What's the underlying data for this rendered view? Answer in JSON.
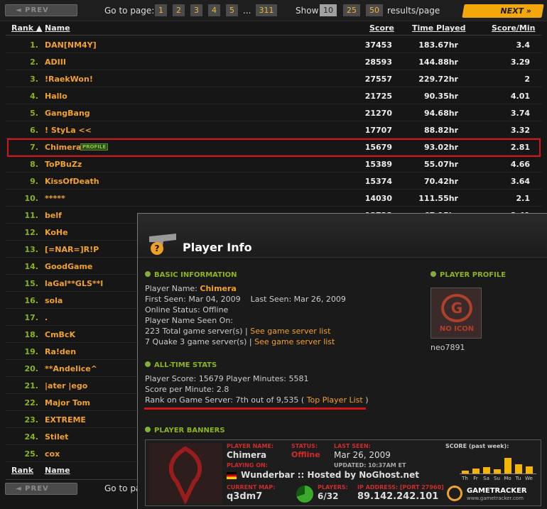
{
  "pager": {
    "prev": "◄ PREV",
    "next": "NEXT »",
    "goto_label": "Go to page:",
    "pages": [
      "1",
      "2",
      "3",
      "4",
      "5",
      "...",
      "311"
    ],
    "show_label": "Show",
    "show_options": [
      "10",
      "25",
      "50"
    ],
    "results_label": "results/page"
  },
  "table": {
    "headers": {
      "rank": "Rank ▲",
      "name": "Name",
      "score": "Score",
      "time": "Time Played",
      "spm": "Score/Min"
    },
    "rows": [
      {
        "rank": "1.",
        "name": "DAN[NM4Y]",
        "score": "37453",
        "time": "183.67hr",
        "spm": "3.4"
      },
      {
        "rank": "2.",
        "name": "ADIII",
        "score": "28593",
        "time": "144.88hr",
        "spm": "3.29"
      },
      {
        "rank": "3.",
        "name": "!RaekWon!",
        "score": "27557",
        "time": "229.72hr",
        "spm": "2"
      },
      {
        "rank": "4.",
        "name": "Hallo",
        "score": "21725",
        "time": "90.35hr",
        "spm": "4.01"
      },
      {
        "rank": "5.",
        "name": "GangBang",
        "score": "21270",
        "time": "94.68hr",
        "spm": "3.74"
      },
      {
        "rank": "6.",
        "name": "! StyLa <<",
        "score": "17707",
        "time": "88.82hr",
        "spm": "3.32"
      },
      {
        "rank": "7.",
        "name": "Chimera",
        "badge": "PROFILE",
        "score": "15679",
        "time": "93.02hr",
        "spm": "2.81"
      },
      {
        "rank": "8.",
        "name": "ToPBuZz",
        "score": "15389",
        "time": "55.07hr",
        "spm": "4.66"
      },
      {
        "rank": "9.",
        "name": "KissOfDeath",
        "score": "15374",
        "time": "70.42hr",
        "spm": "3.64"
      },
      {
        "rank": "10.",
        "name": "*****",
        "score": "14030",
        "time": "111.55hr",
        "spm": "2.1"
      },
      {
        "rank": "11.",
        "name": "belf",
        "score": "13723",
        "time": "67.15hr",
        "spm": "3.41"
      },
      {
        "rank": "12.",
        "name": "KoHe"
      },
      {
        "rank": "13.",
        "name": "[=NAR=]R!P"
      },
      {
        "rank": "14.",
        "name": "GoodGame"
      },
      {
        "rank": "15.",
        "name": "laGal**GLS**l"
      },
      {
        "rank": "16.",
        "name": "sola"
      },
      {
        "rank": "17.",
        "name": "."
      },
      {
        "rank": "18.",
        "name": "CmBcK"
      },
      {
        "rank": "19.",
        "name": "Ra!den"
      },
      {
        "rank": "20.",
        "name": "**Andelice^"
      },
      {
        "rank": "21.",
        "name": "|ater |ego"
      },
      {
        "rank": "22.",
        "name": "Major Tom"
      },
      {
        "rank": "23.",
        "name": "EXTREME"
      },
      {
        "rank": "24.",
        "name": "Stilet"
      },
      {
        "rank": "25.",
        "name": "cox"
      }
    ],
    "footer_rank": "Rank",
    "footer_name": "Name",
    "footer_goto": "Go to pa"
  },
  "player_info": {
    "title": "Player Info",
    "basic_header": "BASIC INFORMATION",
    "name_label": "Player Name:",
    "name_value": "Chimera",
    "first_seen": "First Seen:  Mar 04, 2009",
    "last_seen": "Last Seen:  Mar 26, 2009",
    "online_status": "Online Status:  Offline",
    "name_seen_on": "Player Name Seen On:",
    "total_servers": "223 Total game server(s)  |",
    "see_list_1": "See game server list",
    "quake_servers": "7 Quake 3 game server(s)  |",
    "see_list_2": "See game server list",
    "stats_header": "ALL-TIME STATS",
    "score_line": "Player Score:  15679    Player Minutes:  5581",
    "spm_line": "Score per Minute:  2.8",
    "rank_line": "Rank on Game Server:  7th out of 9,535 (",
    "top_list": "Top Player List",
    "rank_close": ")",
    "profile_header": "PLAYER PROFILE",
    "no_icon": "NO ICON",
    "profile_user": "neo7891",
    "banners_header": "PLAYER BANNERS",
    "icon_glyph": "?",
    "avatar_glyph": "G"
  },
  "banner": {
    "name_label": "PLAYER NAME:",
    "name": "Chimera",
    "status_label": "STATUS:",
    "status": "Offline",
    "last_label": "LAST SEEN:",
    "last": "Mar 26, 2009",
    "playing_label": "PLAYING ON:",
    "updated": "UPDATED: 10:37AM ET",
    "server": "Wunderbar :: Hosted by NoGhost.net",
    "map_label": "CURRENT MAP:",
    "map": "q3dm7",
    "players_label": "PLAYERS:",
    "players": "6/32",
    "ip_label": "IP ADDRESS: [PORT 27960]",
    "ip": "89.142.242.101",
    "score_label": "SCORE (past week):",
    "days": [
      "Th",
      "Fr",
      "Sa",
      "Su",
      "Mo",
      "Tu",
      "We"
    ],
    "week_scores": [
      0.15,
      0.25,
      0.3,
      0.2,
      0.75,
      0.45,
      0.35
    ],
    "gt_name": "GAMETRACKER",
    "gt_url": "www.gametracker.com"
  }
}
